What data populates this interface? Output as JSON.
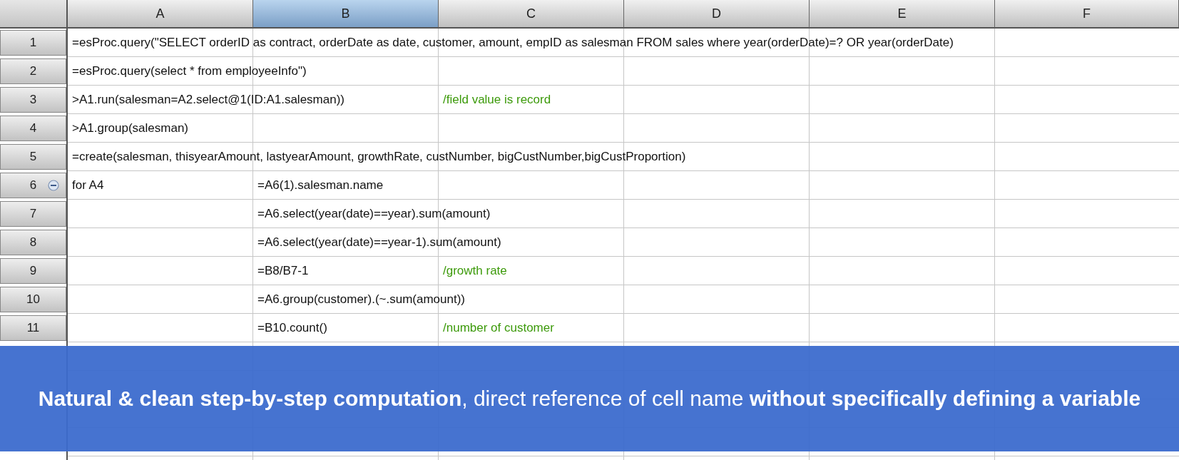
{
  "columns": [
    {
      "label": "A",
      "selected": false
    },
    {
      "label": "B",
      "selected": true
    },
    {
      "label": "C",
      "selected": false
    },
    {
      "label": "D",
      "selected": false
    },
    {
      "label": "E",
      "selected": false
    },
    {
      "label": "F",
      "selected": false
    }
  ],
  "rows": [
    {
      "number": "1",
      "collapsible": false,
      "cells": [
        {
          "kind": "formula",
          "text": "=esProc.query(\"SELECT orderID as contract, orderDate as date, customer, amount, empID as salesman FROM sales where year(orderDate)=? OR year(orderDate)"
        }
      ]
    },
    {
      "number": "2",
      "collapsible": false,
      "cells": [
        {
          "kind": "formula",
          "text": "=esProc.query(select * from employeeInfo\")"
        }
      ]
    },
    {
      "number": "3",
      "collapsible": false,
      "cells": [
        {
          "kind": "formula",
          "text": ">A1.run(salesman=A2.select@1(ID:A1.salesman))"
        },
        {
          "kind": "empty"
        },
        {
          "kind": "comment",
          "text": "/field value is record"
        }
      ]
    },
    {
      "number": "4",
      "collapsible": false,
      "cells": [
        {
          "kind": "formula",
          "text": ">A1.group(salesman)"
        }
      ]
    },
    {
      "number": "5",
      "collapsible": false,
      "cells": [
        {
          "kind": "formula",
          "text": "=create(salesman, thisyearAmount, lastyearAmount, growthRate, custNumber, bigCustNumber,bigCustProportion)"
        }
      ]
    },
    {
      "number": "6",
      "collapsible": true,
      "cells": [
        {
          "kind": "formula",
          "text": "for A4"
        },
        {
          "kind": "formula",
          "text": "=A6(1).salesman.name"
        }
      ]
    },
    {
      "number": "7",
      "collapsible": false,
      "cells": [
        {
          "kind": "empty"
        },
        {
          "kind": "formula",
          "text": "=A6.select(year(date)==year).sum(amount)"
        }
      ]
    },
    {
      "number": "8",
      "collapsible": false,
      "cells": [
        {
          "kind": "empty"
        },
        {
          "kind": "formula",
          "text": "=A6.select(year(date)==year-1).sum(amount)"
        }
      ]
    },
    {
      "number": "9",
      "collapsible": false,
      "cells": [
        {
          "kind": "empty"
        },
        {
          "kind": "formula",
          "text": "=B8/B7-1"
        },
        {
          "kind": "comment",
          "text": "/growth rate"
        }
      ]
    },
    {
      "number": "10",
      "collapsible": false,
      "cells": [
        {
          "kind": "empty"
        },
        {
          "kind": "formula",
          "text": "=A6.group(customer).(~.sum(amount))"
        }
      ]
    },
    {
      "number": "11",
      "collapsible": false,
      "cells": [
        {
          "kind": "empty"
        },
        {
          "kind": "formula",
          "text": "=B10.count()"
        },
        {
          "kind": "comment",
          "text": "/number of customer"
        }
      ]
    },
    {
      "cells": []
    },
    {
      "cells": []
    },
    {
      "cells": []
    },
    {
      "cells": []
    },
    {
      "cells": []
    }
  ],
  "banner": {
    "text": "**Natural & clean step-by-step computation**, direct reference of cell name **without specifically defining a variable**"
  }
}
